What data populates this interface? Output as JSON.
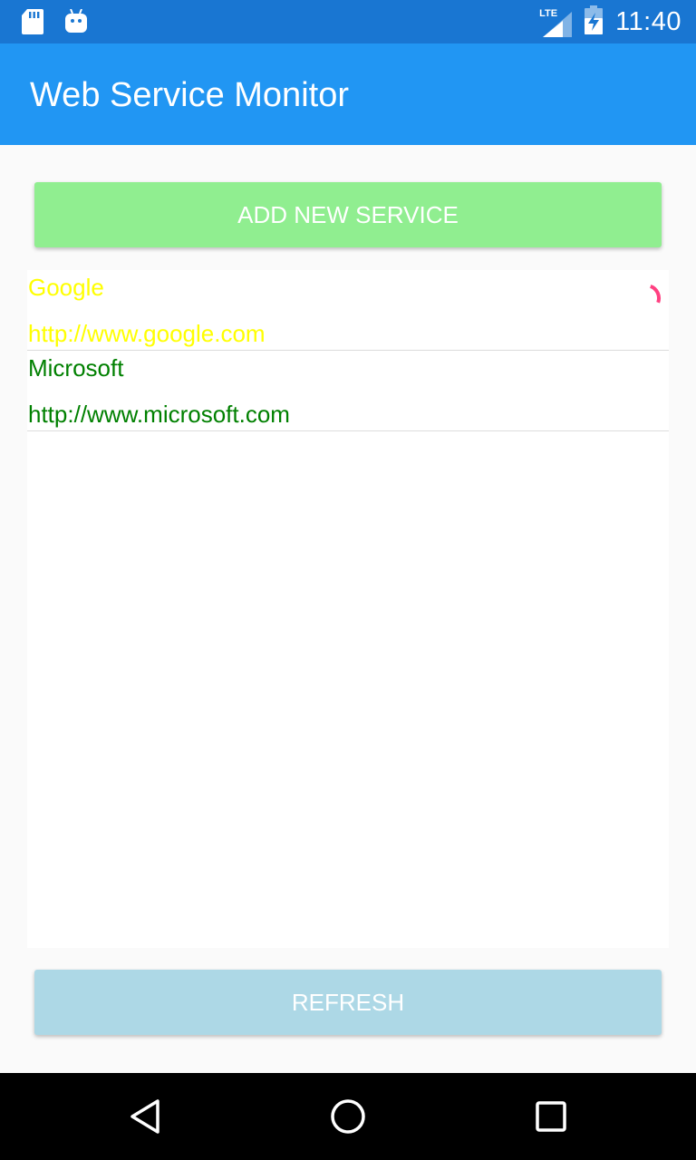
{
  "status_bar": {
    "time": "11:40",
    "network": "LTE",
    "icons": [
      "sd-card-icon",
      "android-icon",
      "lte-signal-icon",
      "battery-charging-icon"
    ]
  },
  "app_bar": {
    "title": "Web Service Monitor"
  },
  "buttons": {
    "add_label": "ADD NEW SERVICE",
    "refresh_label": "REFRESH"
  },
  "services": [
    {
      "name": "Google",
      "url": "http://www.google.com",
      "color": "#ffff00",
      "loading": true
    },
    {
      "name": "Microsoft",
      "url": "http://www.microsoft.com",
      "color": "#008000",
      "loading": false
    }
  ],
  "colors": {
    "status_bar": "#1976d2",
    "app_bar": "#2196f3",
    "add_button": "#90ee90",
    "refresh_button": "#add8e6",
    "spinner": "#ff4081"
  },
  "nav_bar": {
    "icons": [
      "back-icon",
      "home-icon",
      "recents-icon"
    ]
  }
}
